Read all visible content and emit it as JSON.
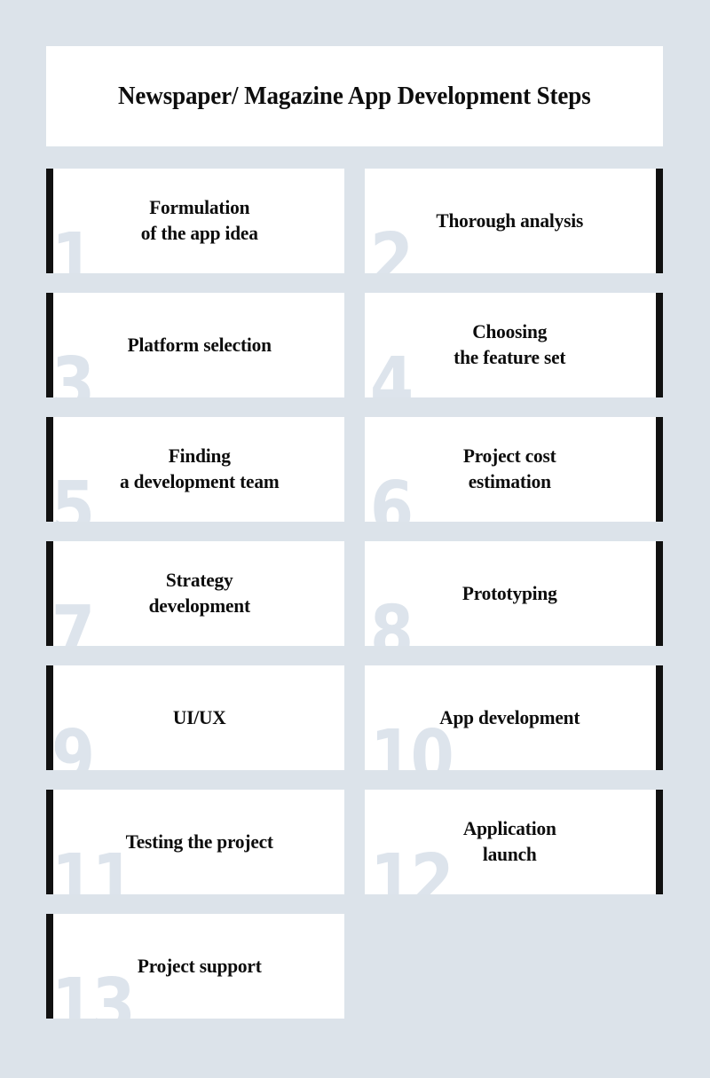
{
  "header": {
    "title": "Newspaper/ Magazine App Development Steps"
  },
  "theme": {
    "page_background": "#dce3ea",
    "card_background": "#ffffff",
    "accent_bar_color": "#111111",
    "number_color": "#dde4ec",
    "text_color": "#0d0d0d"
  },
  "steps": [
    {
      "number": "1",
      "label": "Formulation\nof the app idea",
      "side": "left"
    },
    {
      "number": "2",
      "label": "Thorough analysis",
      "side": "right"
    },
    {
      "number": "3",
      "label": "Platform selection",
      "side": "left"
    },
    {
      "number": "4",
      "label": "Choosing\nthe feature set",
      "side": "right"
    },
    {
      "number": "5",
      "label": "Finding\na development team",
      "side": "left"
    },
    {
      "number": "6",
      "label": "Project cost\nestimation",
      "side": "right"
    },
    {
      "number": "7",
      "label": "Strategy\ndevelopment",
      "side": "left"
    },
    {
      "number": "8",
      "label": "Prototyping",
      "side": "right"
    },
    {
      "number": "9",
      "label": "UI/UX",
      "side": "left"
    },
    {
      "number": "10",
      "label": "App development",
      "side": "right"
    },
    {
      "number": "11",
      "label": "Testing the project",
      "side": "left"
    },
    {
      "number": "12",
      "label": "Application\nlaunch",
      "side": "right"
    },
    {
      "number": "13",
      "label": "Project support",
      "side": "left"
    }
  ]
}
